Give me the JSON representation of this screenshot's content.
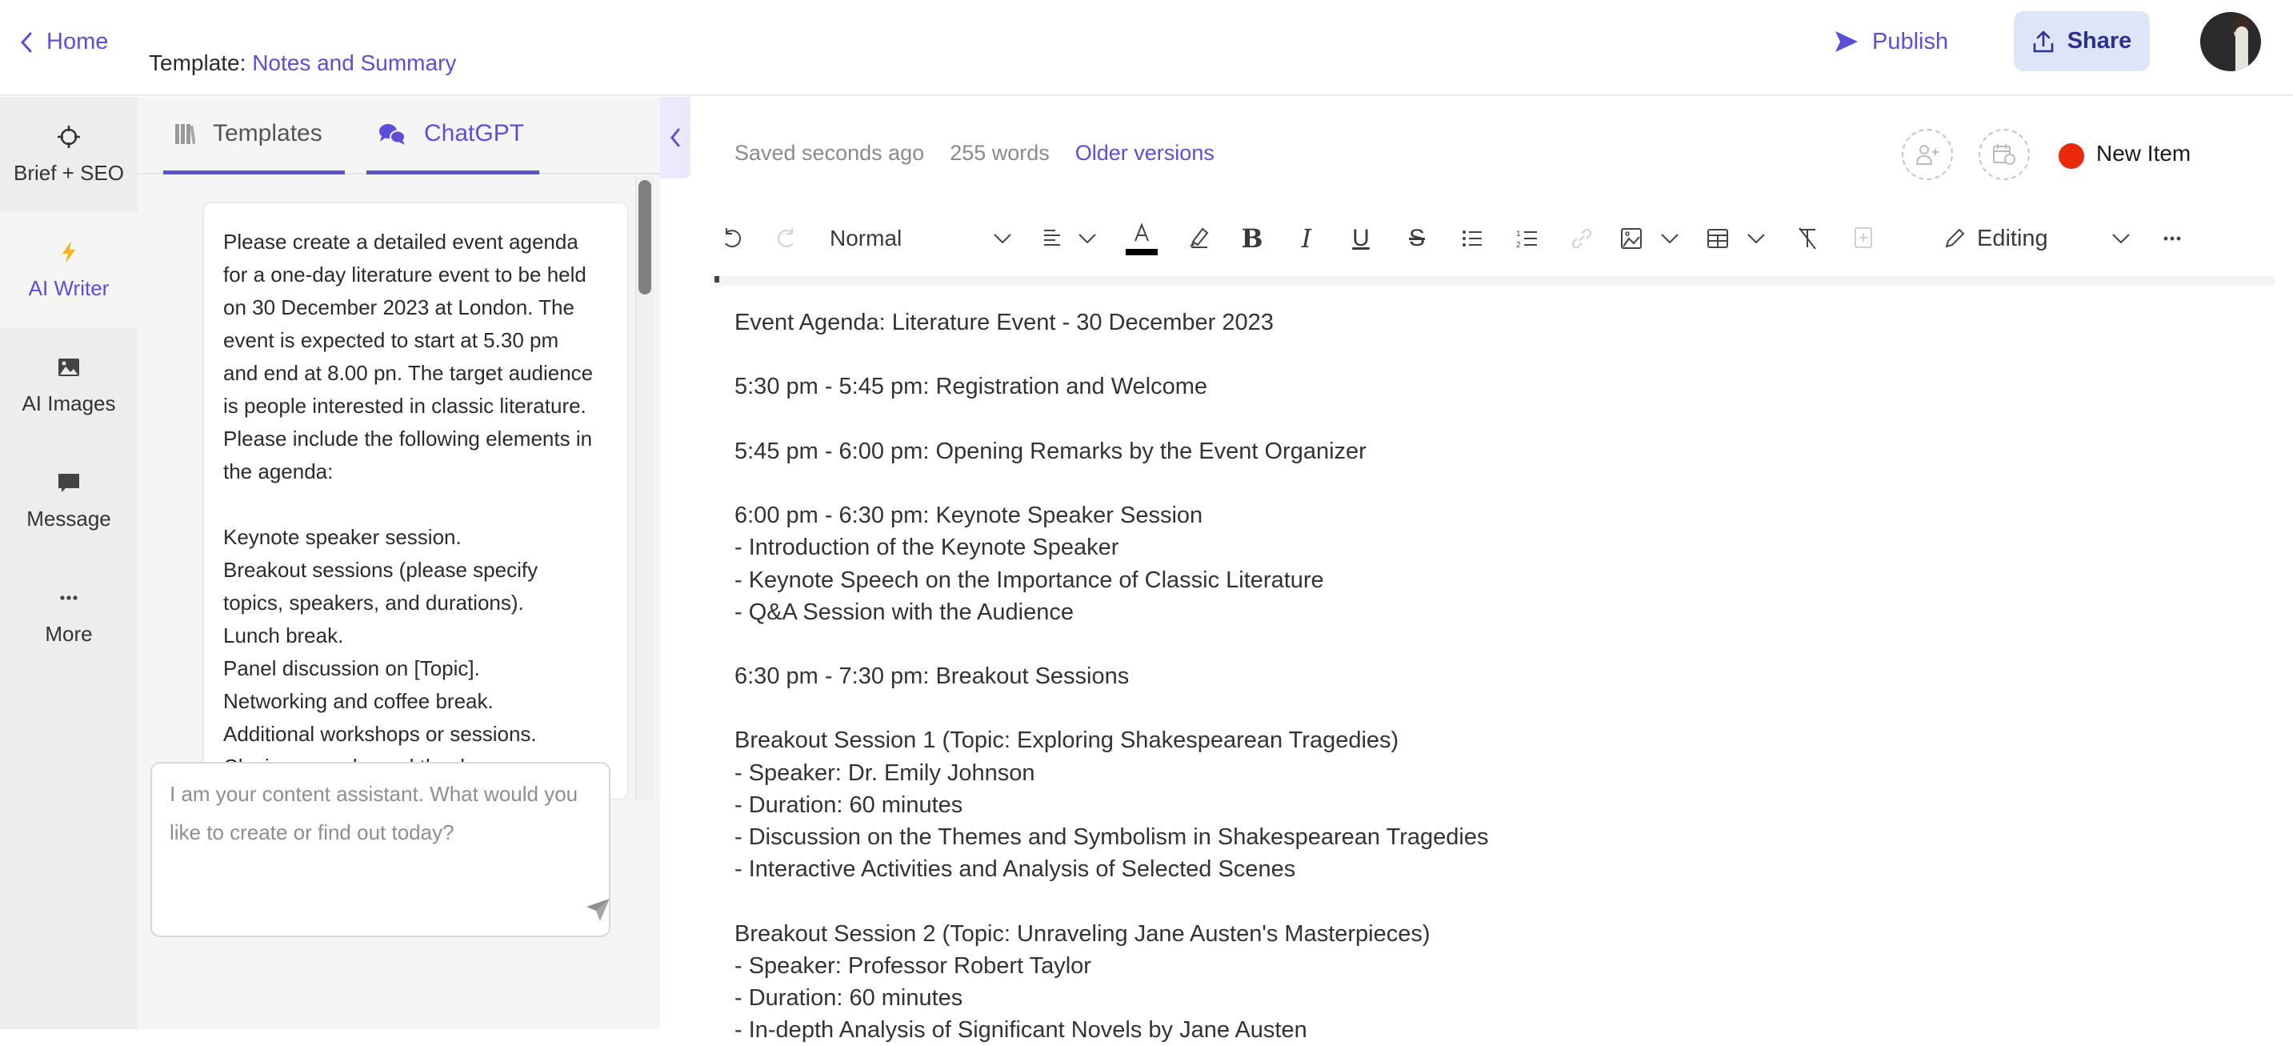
{
  "header": {
    "home_label": "Home",
    "template_prefix": "Template:",
    "template_name": "Notes and Summary",
    "publish_label": "Publish",
    "share_label": "Share"
  },
  "rail": {
    "items": [
      {
        "label": "Brief + SEO",
        "icon": "crosshair-icon",
        "active": false
      },
      {
        "label": "AI Writer",
        "icon": "lightning-icon",
        "active": true
      },
      {
        "label": "AI Images",
        "icon": "image-icon",
        "active": false
      },
      {
        "label": "Message",
        "icon": "message-icon",
        "active": false
      },
      {
        "label": "More",
        "icon": "more-icon",
        "active": false
      }
    ]
  },
  "chat": {
    "tabs": [
      {
        "label": "Templates",
        "icon": "library-icon"
      },
      {
        "label": "ChatGPT",
        "icon": "chat-bubbles-icon",
        "active": true
      }
    ],
    "message": "Please create a detailed event agenda\nfor a one-day literature event to be held\non 30 December 2023 at London. The\nevent is expected to start at 5.30 pm\nand end at 8.00 pn. The target audience\nis people interested in classic literature.\nPlease include the following elements in\nthe agenda:\n\nKeynote speaker session.\nBreakout sessions (please specify\ntopics, speakers, and durations).\nLunch break.\nPanel discussion on [Topic].\nNetworking and coffee break.\nAdditional workshops or sessions.\nClosing remarks and thank you.",
    "input_value": "",
    "input_placeholder": "I am your content assistant. What would you like to create or find out today?"
  },
  "editor": {
    "saved_status": "Saved seconds ago",
    "word_count": "255 words",
    "older_versions_label": "Older versions",
    "item_status_label": "New Item",
    "item_status_color": "#e8290b",
    "toolbar": {
      "style_value": "Normal",
      "editing_mode": "Editing"
    },
    "lines": [
      "Event Agenda: Literature Event - 30 December 2023",
      "",
      "5:30 pm - 5:45 pm: Registration and Welcome",
      "",
      "5:45 pm - 6:00 pm: Opening Remarks by the Event Organizer",
      "",
      "6:00 pm - 6:30 pm: Keynote Speaker Session",
      "- Introduction of the Keynote Speaker",
      "- Keynote Speech on the Importance of Classic Literature",
      "- Q&A Session with the Audience",
      "",
      "6:30 pm - 7:30 pm: Breakout Sessions",
      "",
      "Breakout Session 1 (Topic: Exploring Shakespearean Tragedies)",
      "- Speaker: Dr. Emily Johnson",
      "- Duration: 60 minutes",
      "- Discussion on the Themes and Symbolism in Shakespearean Tragedies",
      "- Interactive Activities and Analysis of Selected Scenes",
      "",
      "Breakout Session 2 (Topic: Unraveling Jane Austen's Masterpieces)",
      "- Speaker: Professor Robert Taylor",
      "- Duration: 60 minutes",
      "- In-depth Analysis of Significant Novels by Jane Austen"
    ]
  },
  "colors": {
    "accent": "#5b4fd8",
    "share_bg": "#dde6f8",
    "share_text": "#2f2f92"
  }
}
